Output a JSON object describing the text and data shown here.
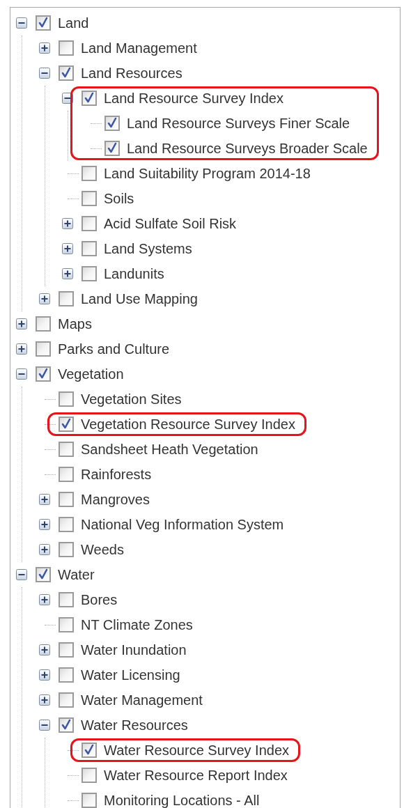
{
  "tree": [
    {
      "label": "Land",
      "checked": true,
      "highlighted": false,
      "expanded": true,
      "children": [
        {
          "label": "Land Management",
          "checked": false,
          "highlighted": false,
          "expanded": false
        },
        {
          "label": "Land Resources",
          "checked": true,
          "highlighted": false,
          "expanded": true,
          "children": [
            {
              "label": "Land Resource Survey Index",
              "checked": true,
              "highlighted": true,
              "expanded": true,
              "children": [
                {
                  "label": "Land Resource Surveys Finer Scale",
                  "checked": true,
                  "highlighted": false
                },
                {
                  "label": "Land Resource Surveys Broader Scale",
                  "checked": true,
                  "highlighted": false
                }
              ]
            },
            {
              "label": "Land Suitability Program 2014-18",
              "checked": false,
              "highlighted": false
            },
            {
              "label": "Soils",
              "checked": false,
              "highlighted": false
            },
            {
              "label": "Acid Sulfate Soil Risk",
              "checked": false,
              "highlighted": false,
              "expanded": false
            },
            {
              "label": "Land Systems",
              "checked": false,
              "highlighted": false,
              "expanded": false
            },
            {
              "label": "Landunits",
              "checked": false,
              "highlighted": false,
              "expanded": false
            }
          ]
        },
        {
          "label": "Land Use Mapping",
          "checked": false,
          "highlighted": false,
          "expanded": false
        }
      ]
    },
    {
      "label": "Maps",
      "checked": false,
      "highlighted": false,
      "expanded": false
    },
    {
      "label": "Parks and Culture",
      "checked": false,
      "highlighted": false,
      "expanded": false
    },
    {
      "label": "Vegetation",
      "checked": true,
      "highlighted": false,
      "expanded": true,
      "children": [
        {
          "label": "Vegetation Sites",
          "checked": false,
          "highlighted": false
        },
        {
          "label": "Vegetation Resource Survey Index",
          "checked": true,
          "highlighted": true
        },
        {
          "label": "Sandsheet Heath Vegetation",
          "checked": false,
          "highlighted": false
        },
        {
          "label": "Rainforests",
          "checked": false,
          "highlighted": false
        },
        {
          "label": "Mangroves",
          "checked": false,
          "highlighted": false,
          "expanded": false
        },
        {
          "label": "National Veg Information System",
          "checked": false,
          "highlighted": false,
          "expanded": false
        },
        {
          "label": "Weeds",
          "checked": false,
          "highlighted": false,
          "expanded": false
        }
      ]
    },
    {
      "label": "Water",
      "checked": true,
      "highlighted": false,
      "expanded": true,
      "children": [
        {
          "label": "Bores",
          "checked": false,
          "highlighted": false,
          "expanded": false
        },
        {
          "label": "NT Climate Zones",
          "checked": false,
          "highlighted": false
        },
        {
          "label": "Water Inundation",
          "checked": false,
          "highlighted": false,
          "expanded": false
        },
        {
          "label": "Water Licensing",
          "checked": false,
          "highlighted": false,
          "expanded": false
        },
        {
          "label": "Water Management",
          "checked": false,
          "highlighted": false,
          "expanded": false
        },
        {
          "label": "Water Resources",
          "checked": true,
          "highlighted": false,
          "expanded": true,
          "children": [
            {
              "label": "Water Resource Survey Index",
              "checked": true,
              "highlighted": true
            },
            {
              "label": "Water Resource Report Index",
              "checked": false,
              "highlighted": false
            },
            {
              "label": "Monitoring Locations - All",
              "checked": false,
              "highlighted": false
            }
          ]
        }
      ]
    }
  ]
}
